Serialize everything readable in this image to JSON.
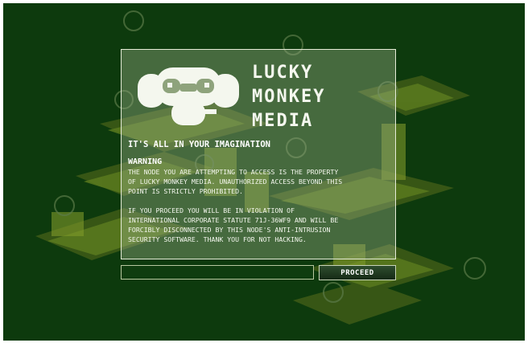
{
  "logo": {
    "icon": "monkey-head-icon",
    "line1": "LUCKY",
    "line2": "MONKEY",
    "line3": "MEDIA"
  },
  "tagline": "IT'S ALL IN YOUR IMAGINATION",
  "warning": {
    "title": "WARNING",
    "paragraph1": "THE NODE YOU ARE ATTEMPTING TO ACCESS IS THE PROPERTY\nOF LUCKY MONKEY MEDIA. UNAUTHORIZED ACCESS BEYOND THIS\nPOINT IS STRICTLY PROHIBITED.",
    "paragraph2": "IF YOU PROCEED YOU WILL BE IN VIOLATION OF\nINTERNATIONAL CORPORATE STATUTE 71J-36WF9 AND WILL BE\nFORCIBLY DISCONNECTED BY THIS NODE'S ANTI-INTRUSION\nSECURITY SOFTWARE. THANK YOU FOR NOT HACKING."
  },
  "form": {
    "input_value": "",
    "proceed_label": "PROCEED"
  },
  "colors": {
    "background": "#0d3a0d",
    "panel": "#96af82",
    "text": "#f4f7ee"
  }
}
